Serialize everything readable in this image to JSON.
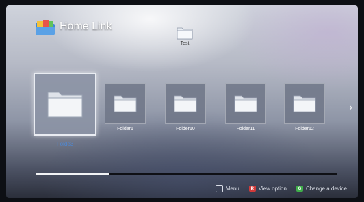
{
  "header": {
    "title": "Home Link",
    "icon": "home-link-icon"
  },
  "test_folder": {
    "label": "Test",
    "icon": "folder-icon"
  },
  "folders": [
    {
      "name": "Folde3",
      "selected": true
    },
    {
      "name": "Folder1",
      "selected": false
    },
    {
      "name": "Folder10",
      "selected": false
    },
    {
      "name": "Folder11",
      "selected": false
    },
    {
      "name": "Folder12",
      "selected": false
    }
  ],
  "scroll": {
    "progress": 0.24
  },
  "footer": {
    "menu_label": "Menu",
    "view_option_label": "View option",
    "view_option_key": "R",
    "view_option_color": "#d13a3a",
    "change_device_label": "Change a device",
    "change_device_key": "G",
    "change_device_color": "#3fae4a"
  }
}
